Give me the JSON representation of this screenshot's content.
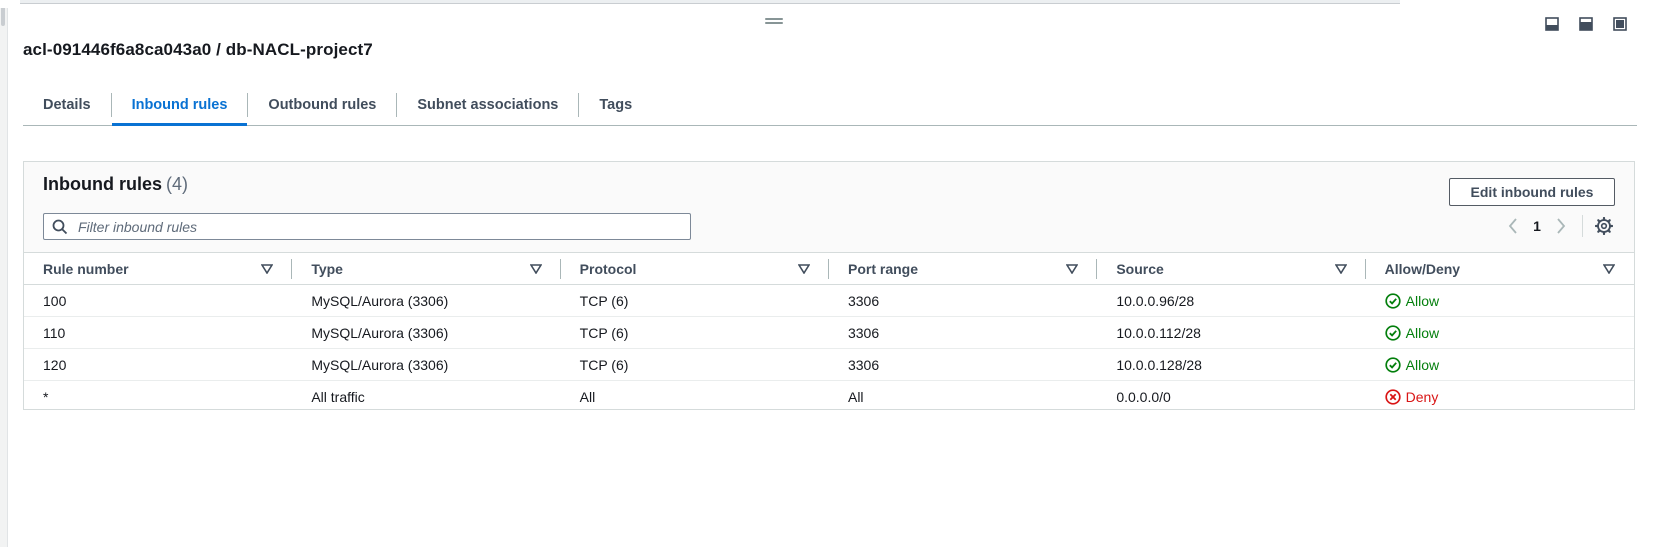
{
  "header": {
    "title": "acl-091446f6a8ca043a0 / db-NACL-project7"
  },
  "tabs": [
    {
      "label": "Details",
      "active": false
    },
    {
      "label": "Inbound rules",
      "active": true
    },
    {
      "label": "Outbound rules",
      "active": false
    },
    {
      "label": "Subnet associations",
      "active": false
    },
    {
      "label": "Tags",
      "active": false
    }
  ],
  "panel": {
    "title": "Inbound rules",
    "count": "(4)",
    "edit_button": "Edit inbound rules",
    "filter_placeholder": "Filter inbound rules",
    "page": "1"
  },
  "table": {
    "columns": [
      "Rule number",
      "Type",
      "Protocol",
      "Port range",
      "Source",
      "Allow/Deny"
    ],
    "rows": [
      {
        "rule": "100",
        "type": "MySQL/Aurora (3306)",
        "protocol": "TCP (6)",
        "port": "3306",
        "source": "10.0.0.96/28",
        "action": "Allow"
      },
      {
        "rule": "110",
        "type": "MySQL/Aurora (3306)",
        "protocol": "TCP (6)",
        "port": "3306",
        "source": "10.0.0.112/28",
        "action": "Allow"
      },
      {
        "rule": "120",
        "type": "MySQL/Aurora (3306)",
        "protocol": "TCP (6)",
        "port": "3306",
        "source": "10.0.0.128/28",
        "action": "Allow"
      },
      {
        "rule": "*",
        "type": "All traffic",
        "protocol": "All",
        "port": "All",
        "source": "0.0.0.0/0",
        "action": "Deny"
      }
    ]
  },
  "colors": {
    "accent": "#0972d3",
    "allow": "#037f0c",
    "deny": "#d91515"
  },
  "icons": {
    "layout": [
      "panel-bottom-icon",
      "panel-side-icon",
      "panel-full-icon"
    ],
    "search": "search-icon",
    "allow": "check-circle-icon",
    "deny": "x-circle-icon",
    "settings": "gear-icon"
  }
}
